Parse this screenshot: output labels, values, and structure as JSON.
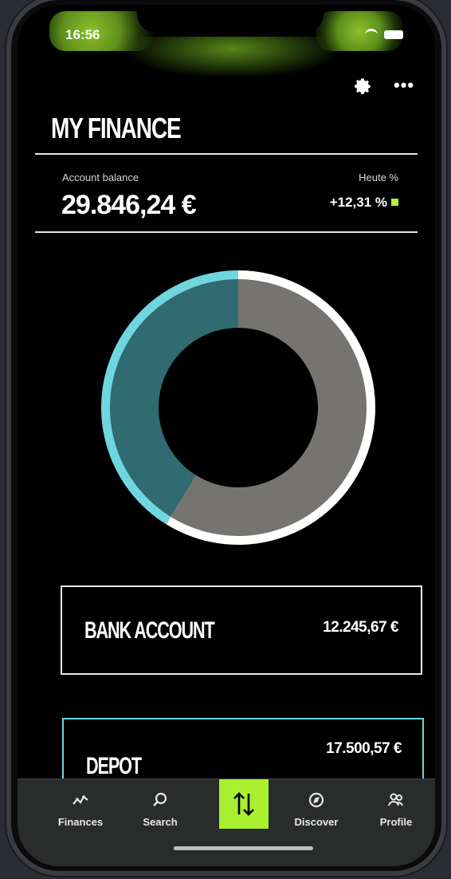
{
  "status_bar": {
    "time": "16:56"
  },
  "header": {
    "title": "MY FINANCE"
  },
  "balance": {
    "label": "Account balance",
    "value": "29.846,24 €",
    "change_label": "Heute %",
    "change_value": "+12,31 %",
    "accent": "#b4f23a"
  },
  "chart_data": {
    "type": "pie",
    "values": [
      12245.67,
      17500.57
    ]
  },
  "accounts": [
    {
      "title": "BANK ACCOUNT",
      "value": "12.245,67 €"
    },
    {
      "title": "DEPOT",
      "value": "17.500,57 €"
    }
  ],
  "tabs": [
    {
      "label": "Finances",
      "icon": "finances-icon"
    },
    {
      "label": "Search",
      "icon": "search-icon"
    },
    {
      "label": "",
      "icon": "transfer-arrows-icon"
    },
    {
      "label": "Discover",
      "icon": "discover-icon"
    },
    {
      "label": "Profile",
      "icon": "profile-icon"
    }
  ],
  "colors": {
    "accent_green": "#a8f030",
    "teal": "#2f6b70",
    "cyan_ring": "#6fd6e0",
    "gray_segment": "#767470"
  }
}
